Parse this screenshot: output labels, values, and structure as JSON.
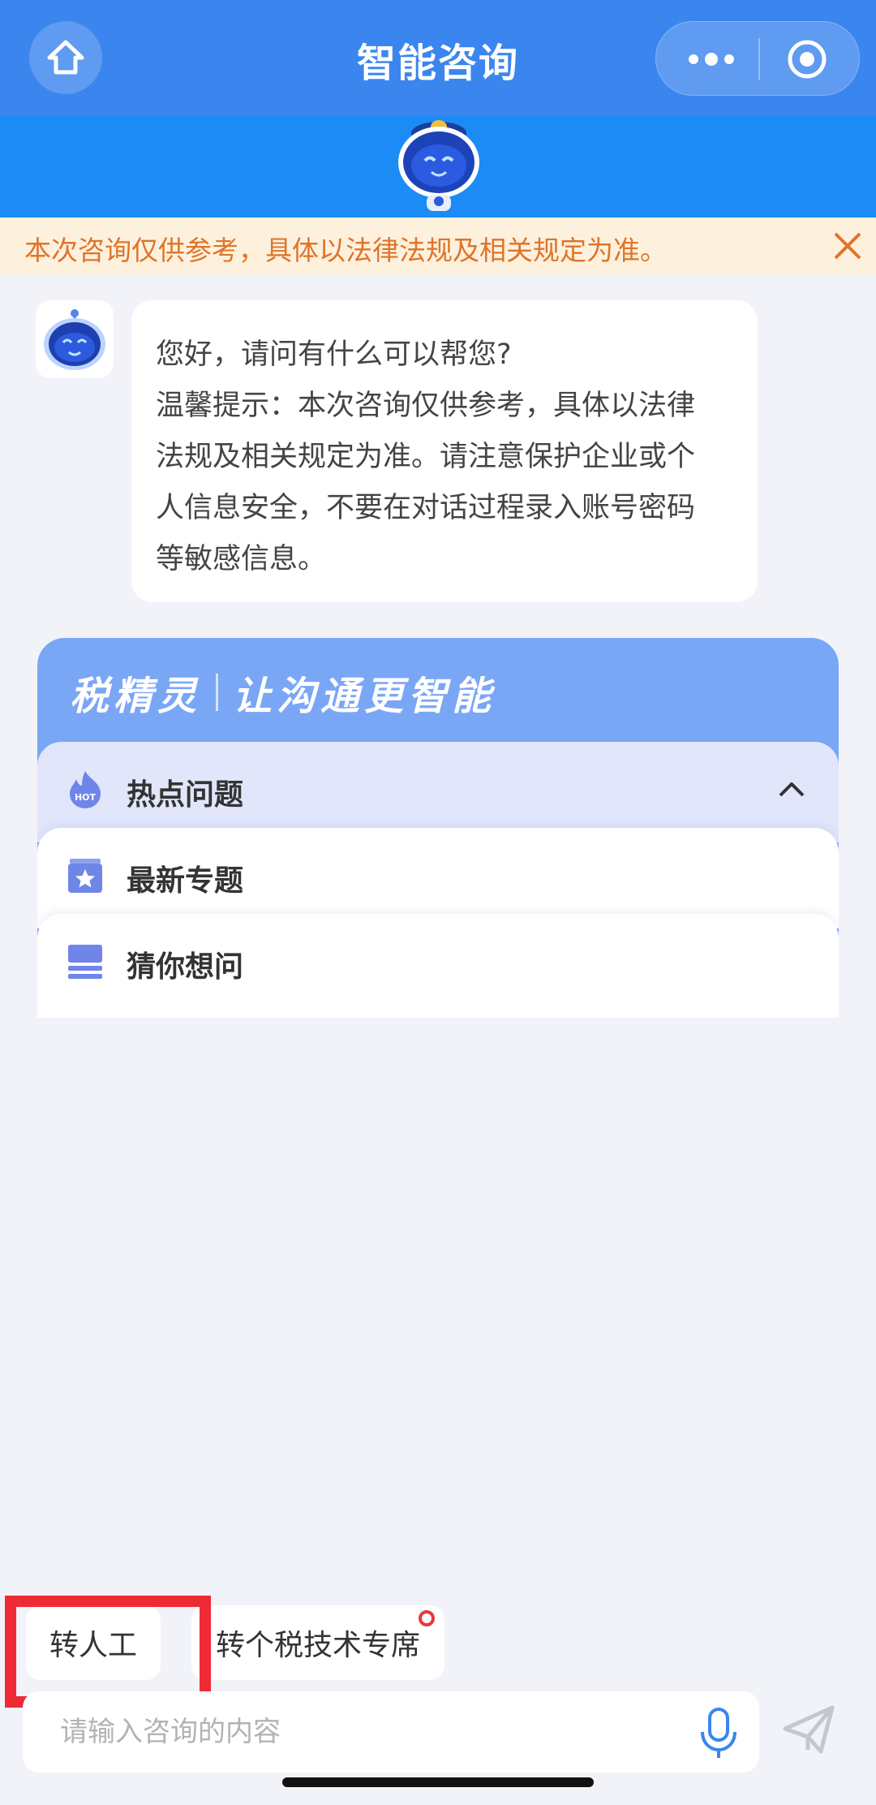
{
  "header": {
    "title": "智能咨询",
    "home_icon": "home-icon",
    "more_icon": "more-dots-icon",
    "target_icon": "target-icon",
    "background": "#3b86ee"
  },
  "banner": {
    "background": "#1c8bf5",
    "mascot": "robot-mascot"
  },
  "notice": {
    "text": "本次咨询仅供参考，具体以法律法规及相关规定为准。",
    "close_icon": "close-icon",
    "text_color": "#e07428"
  },
  "message": {
    "lines": [
      "您好，请问有什么可以帮您?",
      "温馨提示：本次咨询仅供参考，具体以法律",
      "法规及相关规定为准。请注意保护企业或个",
      "人信息安全，不要在对话过程录入账号密码",
      "等敏感信息。"
    ]
  },
  "card": {
    "slogan_left": "税精灵",
    "slogan_right": "让沟通更智能",
    "rows": [
      {
        "label": "热点问题",
        "icon": "hot-flame-icon",
        "expanded": true
      },
      {
        "label": "最新专题",
        "icon": "star-topic-icon"
      },
      {
        "label": "猜你想问",
        "icon": "list-stack-icon"
      }
    ]
  },
  "chips": {
    "human": "转人工",
    "tech": "转个税技术专席"
  },
  "input": {
    "placeholder": "请输入咨询的内容",
    "mic_icon": "microphone-icon",
    "send_icon": "send-icon"
  },
  "colors": {
    "accent": "#3b86ee",
    "highlight": "#ee2b35",
    "badge": "#e5393d"
  }
}
